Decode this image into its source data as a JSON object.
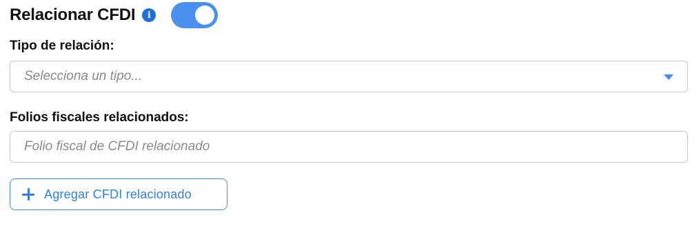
{
  "section": {
    "title": "Relacionar CFDI",
    "info_icon_glyph": "i",
    "toggle_state": "on"
  },
  "tipo_relacion": {
    "label": "Tipo de relación:",
    "placeholder": "Selecciona un tipo..."
  },
  "folios": {
    "label": "Folios fiscales relacionados:",
    "placeholder": "Folio fiscal de CFDI relacionado"
  },
  "add_button": {
    "label": "Agregar CFDI relacionado"
  },
  "colors": {
    "accent": "#4a90f0",
    "info_icon": "#1f6fd8",
    "border": "#c8c8c8",
    "placeholder": "#8a8a8a"
  },
  "icons": [
    "info-icon",
    "chevron-down-icon",
    "plus-icon"
  ]
}
